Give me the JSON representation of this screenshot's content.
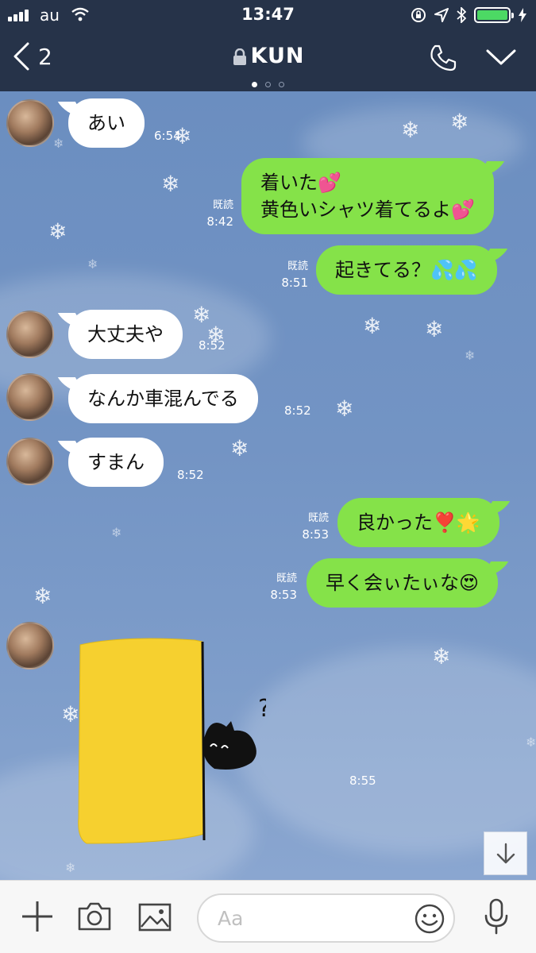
{
  "status_bar": {
    "carrier": "au",
    "time": "13:47"
  },
  "header": {
    "back_count": "2",
    "title": "KUN"
  },
  "messages": [
    {
      "dir": "in",
      "text": "あい",
      "time": "6:54"
    },
    {
      "dir": "out",
      "lines": [
        "着いた💕",
        "黄色いシャツ着てるよ💕"
      ],
      "read": "既読",
      "time": "8:42"
    },
    {
      "dir": "out",
      "text": "起きてる？💦💦",
      "read": "既読",
      "time": "8:51"
    },
    {
      "dir": "in",
      "text": "大丈夫や",
      "time": "8:52"
    },
    {
      "dir": "in",
      "text": "なんか車混んでる",
      "time": "8:52"
    },
    {
      "dir": "in",
      "text": "すまん",
      "time": "8:52"
    },
    {
      "dir": "out",
      "text": "良かった❣️🌟",
      "read": "既読",
      "time": "8:53"
    },
    {
      "dir": "out",
      "text": "早く会ぃたぃな😍",
      "read": "既読",
      "time": "8:53"
    },
    {
      "dir": "in",
      "sticker": "yellow-block-black-creature-question",
      "time": "8:55"
    }
  ],
  "input": {
    "placeholder": "Aa"
  },
  "colors": {
    "header_bg": "#263349",
    "outgoing_bubble": "#85e249",
    "incoming_bubble": "#ffffff",
    "chat_bg": "#7394c4",
    "battery": "#4cd964"
  },
  "icons": [
    "back-chevron-icon",
    "lock-icon",
    "phone-icon",
    "chevron-down-icon",
    "plus-icon",
    "camera-icon",
    "image-icon",
    "emoji-icon",
    "microphone-icon",
    "arrow-down-icon"
  ]
}
